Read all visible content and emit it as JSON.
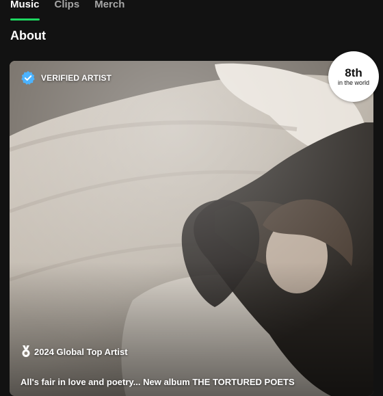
{
  "tabs": [
    {
      "label": "Music",
      "active": true
    },
    {
      "label": "Clips",
      "active": false
    },
    {
      "label": "Merch",
      "active": false
    }
  ],
  "about": {
    "title": "About",
    "verified_label": "VERIFIED ARTIST",
    "rank": {
      "number": "8th",
      "caption": "in the world"
    },
    "award_label": "2024 Global Top Artist",
    "bio_preview": "All's fair in love and poetry... New album THE TORTURED POETS"
  },
  "colors": {
    "background": "#121212",
    "accent": "#1ed760",
    "verified_badge": "#4cb3ff",
    "inactive_tab": "#a7a7a7"
  },
  "icons": [
    "verified-check-icon",
    "medal-icon"
  ]
}
